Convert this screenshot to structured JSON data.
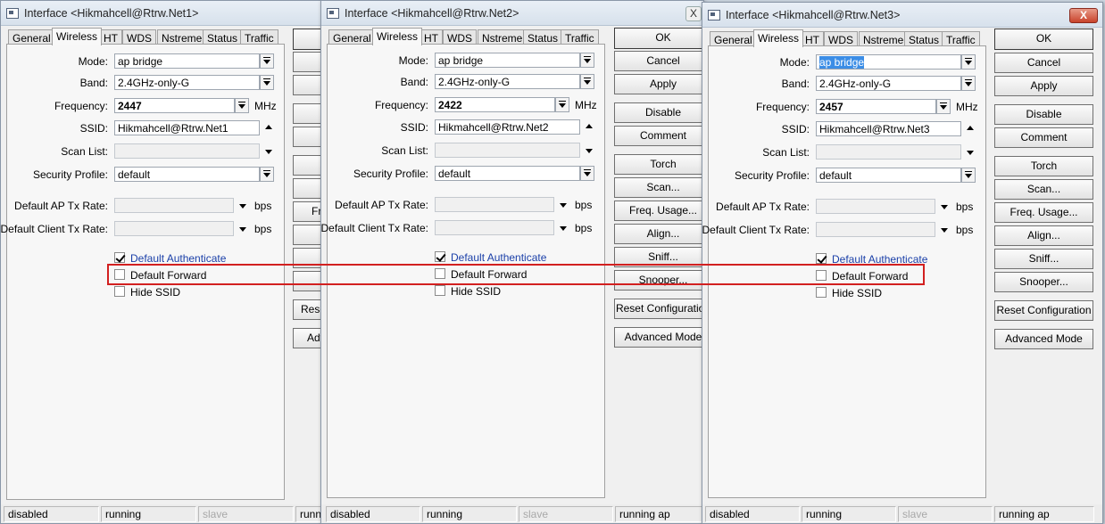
{
  "tabs": [
    "General",
    "Wireless",
    "HT",
    "WDS",
    "Nstreme",
    "Status",
    "Traffic"
  ],
  "labels": {
    "mode": "Mode:",
    "band": "Band:",
    "frequency": "Frequency:",
    "ssid": "SSID:",
    "scan_list": "Scan List:",
    "security_profile": "Security Profile:",
    "default_ap_tx_rate": "Default AP Tx Rate:",
    "default_client_tx_rate": "Default Client Tx Rate:",
    "mhz": "MHz",
    "bps": "bps"
  },
  "checkboxes": {
    "default_authenticate": {
      "label": "Default Authenticate",
      "checked": true
    },
    "default_forward": {
      "label": "Default Forward",
      "checked": false
    },
    "hide_ssid": {
      "label": "Hide SSID",
      "checked": false
    }
  },
  "buttons": [
    "OK",
    "Cancel",
    "Apply",
    "Disable",
    "Comment",
    "Torch",
    "Scan...",
    "Freq. Usage...",
    "Align...",
    "Sniff...",
    "Snooper...",
    "Reset Configuration",
    "Advanced Mode"
  ],
  "partial_buttons": {
    "fr": "Fr",
    "reset": "Rese",
    "adv": "Adv"
  },
  "windows": [
    {
      "title": "Interface <Hikmahcell@Rtrw.Net1>",
      "mode": "ap bridge",
      "band": "2.4GHz-only-G",
      "frequency": "2447",
      "ssid": "Hikmahcell@Rtrw.Net1",
      "scan_list": "",
      "security_profile": "default",
      "default_ap_tx_rate": "",
      "default_client_tx_rate": "",
      "status": [
        "disabled",
        "running",
        "slave",
        "running ap"
      ]
    },
    {
      "title": "Interface <Hikmahcell@Rtrw.Net2>",
      "mode": "ap bridge",
      "band": "2.4GHz-only-G",
      "frequency": "2422",
      "ssid": "Hikmahcell@Rtrw.Net2",
      "scan_list": "",
      "security_profile": "default",
      "default_ap_tx_rate": "",
      "default_client_tx_rate": "",
      "status": [
        "disabled",
        "running",
        "slave",
        "running ap"
      ]
    },
    {
      "title": "Interface <Hikmahcell@Rtrw.Net3>",
      "mode": "ap bridge",
      "band": "2.4GHz-only-G",
      "frequency": "2457",
      "ssid": "Hikmahcell@Rtrw.Net3",
      "scan_list": "",
      "security_profile": "default",
      "default_ap_tx_rate": "",
      "default_client_tx_rate": "",
      "status": [
        "disabled",
        "running",
        "slave",
        "running ap"
      ]
    }
  ],
  "close_glyph": "X",
  "colors": {
    "highlight": "#d22020",
    "checkbox_blue_label": "#1a3fa8",
    "selection": "#3b8de6"
  }
}
